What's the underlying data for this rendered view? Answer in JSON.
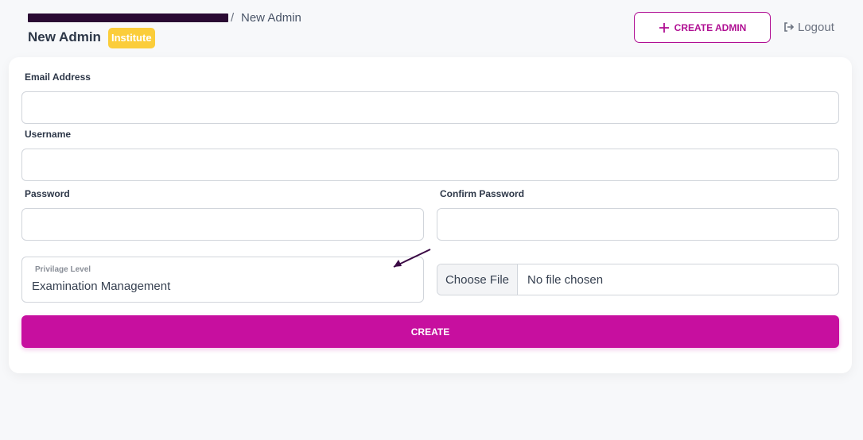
{
  "header": {
    "breadcrumb_separator": "/",
    "breadcrumb_current": "New Admin",
    "title": "New Admin",
    "badge": "Institute",
    "create_admin_label": "CREATE ADMIN",
    "logout_label": "Logout"
  },
  "form": {
    "email_label": "Email Address",
    "email_value": "",
    "username_label": "Username",
    "username_value": "",
    "password_label": "Password",
    "password_value": "",
    "confirm_password_label": "Confirm Password",
    "confirm_password_value": "",
    "privilege_label": "Privilage Level",
    "privilege_value": "Examination Management",
    "file_button_label": "Choose File",
    "file_status": "No file chosen",
    "submit_label": "CREATE"
  },
  "colors": {
    "accent": "#c70f9f",
    "badge": "#fbcd3a",
    "redaction": "#2a0a33"
  },
  "icons": {
    "create_admin": "plus-icon",
    "logout": "sign-out-icon",
    "annotation": "arrow-annotation"
  }
}
